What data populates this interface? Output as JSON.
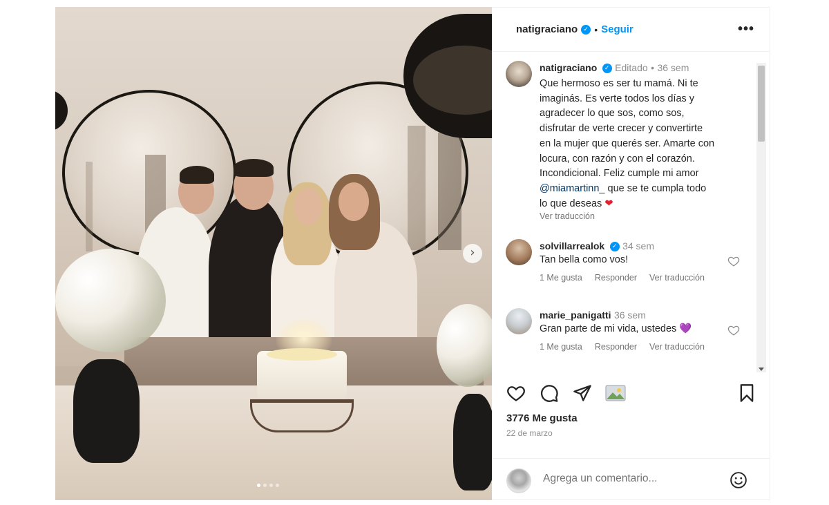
{
  "post": {
    "image_alt": "",
    "carousel": {
      "slides": 4,
      "active": 1
    }
  },
  "header": {
    "username": "natigraciano",
    "separator": "•",
    "follow_label": "Seguir",
    "more_label": "•••"
  },
  "caption": {
    "username": "natigraciano",
    "edited_label": "Editado",
    "separator": "•",
    "time": "36 sem",
    "lines": [
      "Que hermoso es ser tu mamá. Ni te",
      "imaginás. Es verte todos los días y",
      "agradecer lo que sos, como sos,",
      "disfrutar de verte crecer y convertirte",
      "en la mujer que querés ser. Amarte con",
      "locura, con razón y con el corazón.",
      "Incondicional. Feliz cumple mi amor"
    ],
    "mention": "@miamartinn_",
    "line_after_mention": " que se te cumpla todo",
    "last_line": "lo que deseas",
    "emoji": "❤",
    "see_translation": "Ver traducción"
  },
  "comments": [
    {
      "username": "solvillarrealok",
      "verified": true,
      "time": "34 sem",
      "text": "Tan bella como vos!",
      "likes_label": "1 Me gusta",
      "reply_label": "Responder",
      "translate_label": "Ver traducción"
    },
    {
      "username": "marie_panigatti",
      "verified": false,
      "time": "36 sem",
      "text": "Gran parte de mi vida, ustedes",
      "emoji": "💜",
      "likes_label": "1 Me gusta",
      "reply_label": "Responder",
      "translate_label": "Ver traducción"
    }
  ],
  "stats": {
    "likes": "3776 Me gusta",
    "date": "22 de marzo"
  },
  "composer": {
    "placeholder": "Agrega un comentario..."
  },
  "colors": {
    "accent": "#0095f6",
    "text": "#262626",
    "muted": "#737373",
    "heart_red": "#e0202e",
    "heart_purple": "#7b4fd6"
  }
}
